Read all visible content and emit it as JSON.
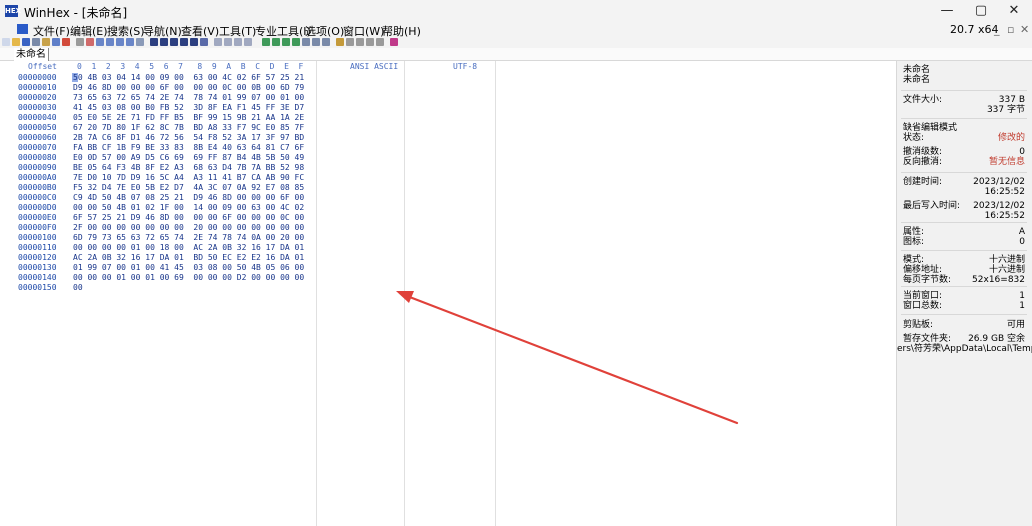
{
  "window": {
    "title": "WinHex - [未命名]",
    "app_icon": "winhex-app-icon",
    "controls": [
      "—",
      "▢",
      "✕"
    ]
  },
  "menu": {
    "items": [
      "文件(F)",
      "编辑(E)",
      "搜索(S)",
      "导航(N)",
      "查看(V)",
      "工具(T)",
      "专业工具(I)",
      "选项(O)",
      "窗口(W)",
      "帮助(H)"
    ],
    "version": "20.7 x64",
    "doc_controls": [
      "_",
      "▫",
      "✕"
    ]
  },
  "tab": {
    "label": "未命名"
  },
  "editor": {
    "offset_header": "Offset",
    "hex_header": "0  1  2  3  4  5  6  7   8  9  A  B  C  D  E  F",
    "ansi_header": "ANSI ASCII",
    "utf8_header": "UTF-8",
    "rows": [
      {
        "offset": "00000000",
        "hex": "50 4B 03 04 14 00 09 00  63 00 4C 02 6F 57 25 21"
      },
      {
        "offset": "00000010",
        "hex": "D9 46 8D 00 00 00 6F 00  00 00 0C 00 0B 00 6D 79"
      },
      {
        "offset": "00000020",
        "hex": "73 65 63 72 65 74 2E 74  78 74 01 99 07 00 01 00"
      },
      {
        "offset": "00000030",
        "hex": "41 45 03 08 00 B0 FB 52  3D 8F EA F1 45 FF 3E D7"
      },
      {
        "offset": "00000040",
        "hex": "05 E0 5E 2E 71 FD FF B5  BF 99 15 9B 21 AA 1A 2E"
      },
      {
        "offset": "00000050",
        "hex": "67 20 7D 80 1F 62 8C 7B  BD A8 33 F7 9C E0 85 7F"
      },
      {
        "offset": "00000060",
        "hex": "2B 7A C6 8F D1 46 72 56  54 F8 52 3A 17 3F 97 BD"
      },
      {
        "offset": "00000070",
        "hex": "FA BB CF 1B F9 BE 33 83  8B E4 40 63 64 81 C7 6F"
      },
      {
        "offset": "00000080",
        "hex": "E0 0D 57 00 A9 D5 C6 69  69 FF 87 B4 4B 5B 50 49"
      },
      {
        "offset": "00000090",
        "hex": "BE 05 64 F3 4B 8F E2 A3  68 63 D4 7B 7A BB 52 98"
      },
      {
        "offset": "000000A0",
        "hex": "7E D0 10 7D D9 16 5C A4  A3 11 41 B7 CA AB 90 FC"
      },
      {
        "offset": "000000B0",
        "hex": "F5 32 D4 7E E0 5B E2 D7  4A 3C 07 0A 92 E7 08 85"
      },
      {
        "offset": "000000C0",
        "hex": "C9 4D 50 4B 07 08 25 21  D9 46 8D 00 00 00 6F 00"
      },
      {
        "offset": "000000D0",
        "hex": "00 00 50 4B 01 02 1F 00  14 00 09 00 63 00 4C 02"
      },
      {
        "offset": "000000E0",
        "hex": "6F 57 25 21 D9 46 8D 00  00 00 6F 00 00 00 0C 00"
      },
      {
        "offset": "000000F0",
        "hex": "2F 00 00 00 00 00 00 00  20 00 00 00 00 00 00 00"
      },
      {
        "offset": "00000100",
        "hex": "6D 79 73 65 63 72 65 74  2E 74 78 74 0A 00 20 00"
      },
      {
        "offset": "00000110",
        "hex": "00 00 00 00 01 00 18 00  AC 2A 0B 32 16 17 DA 01"
      },
      {
        "offset": "00000120",
        "hex": "AC 2A 0B 32 16 17 DA 01  BD 50 EC E2 E2 16 DA 01"
      },
      {
        "offset": "00000130",
        "hex": "01 99 07 00 01 00 41 45  03 08 00 50 4B 05 06 00"
      },
      {
        "offset": "00000140",
        "hex": "00 00 00 01 00 01 00 69  00 00 00 D2 00 00 00 00"
      },
      {
        "offset": "00000150",
        "hex": "00"
      }
    ]
  },
  "info_panel": {
    "items": [
      {
        "label": "未命名",
        "value": ""
      },
      {
        "label": "未命名",
        "value": ""
      },
      {
        "label": "文件大小:",
        "value": "337 B"
      },
      {
        "label": "",
        "value": "337 字节"
      },
      {
        "label": "缺省编辑模式",
        "value": ""
      },
      {
        "label": "状态:",
        "value": "修改的"
      },
      {
        "label": "撤消级数:",
        "value": "0"
      },
      {
        "label": "反向撤消:",
        "value": "暂无信息"
      },
      {
        "label": "创建时间:",
        "value": "2023/12/02"
      },
      {
        "label": "",
        "value": "16:25:52"
      },
      {
        "label": "最后写入时间:",
        "value": "2023/12/02"
      },
      {
        "label": "",
        "value": "16:25:52"
      },
      {
        "label": "属性:",
        "value": "A"
      },
      {
        "label": "图标:",
        "value": "0"
      },
      {
        "label": "模式:",
        "value": "十六进制"
      },
      {
        "label": "偏移地址:",
        "value": "十六进制"
      },
      {
        "label": "每页字节数:",
        "value": "52x16=832"
      },
      {
        "label": "当前窗口:",
        "value": "1"
      },
      {
        "label": "窗口总数:",
        "value": "1"
      },
      {
        "label": "剪贴板:",
        "value": "可用"
      },
      {
        "label": "暂存文件夹:",
        "value": "26.9 GB 空余"
      },
      {
        "label": "ers\\符芳荣\\AppData\\Local\\Temp",
        "value": ""
      }
    ]
  },
  "colors": {
    "annotation_arrow": "#e0413a",
    "offset_text": "#1c48a8",
    "hex_text": "#18358a",
    "panel_bg": "#f1f1f1",
    "status_value": "#c0392b"
  }
}
